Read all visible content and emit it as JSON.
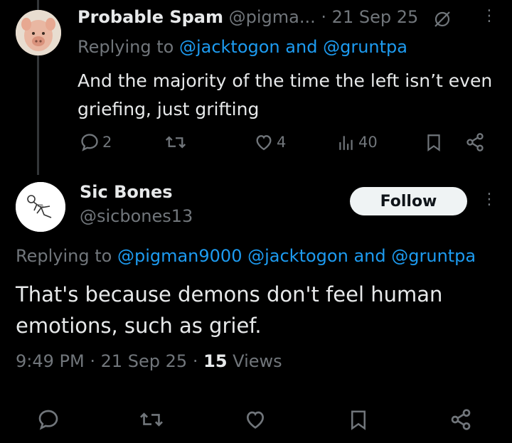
{
  "reply": {
    "display_name": "Probable Spam",
    "handle": "@pigma...",
    "sep": "·",
    "date": "21 Sep 25",
    "replying_prefix": "Replying to",
    "replying_user1": "@jacktogon",
    "replying_and": "and",
    "replying_user2": "@gruntpa",
    "text_line1": "And the majority of the time the left isn’t even",
    "text_line2": "griefing, just grifting",
    "stats": {
      "replies": "2",
      "retweets": "",
      "likes": "4",
      "views": "40"
    }
  },
  "main": {
    "display_name": "Sic Bones",
    "handle": "@sicbones13",
    "follow_label": "Follow",
    "replying_prefix": "Replying to",
    "replying_user1": "@pigman9000",
    "replying_user2": "@jacktogon",
    "replying_and": "and",
    "replying_user3": "@gruntpa",
    "text_line1": "That's because demons don't feel human",
    "text_line2": "emotions, such as grief.",
    "time": "9:49 PM",
    "sep1": "·",
    "date": "21 Sep 25",
    "sep2": "·",
    "views_count": "15",
    "views_label": "Views"
  },
  "colors": {
    "background": "#000000",
    "text": "#e7e9ea",
    "muted": "#71767b",
    "link": "#1d9bf0"
  }
}
